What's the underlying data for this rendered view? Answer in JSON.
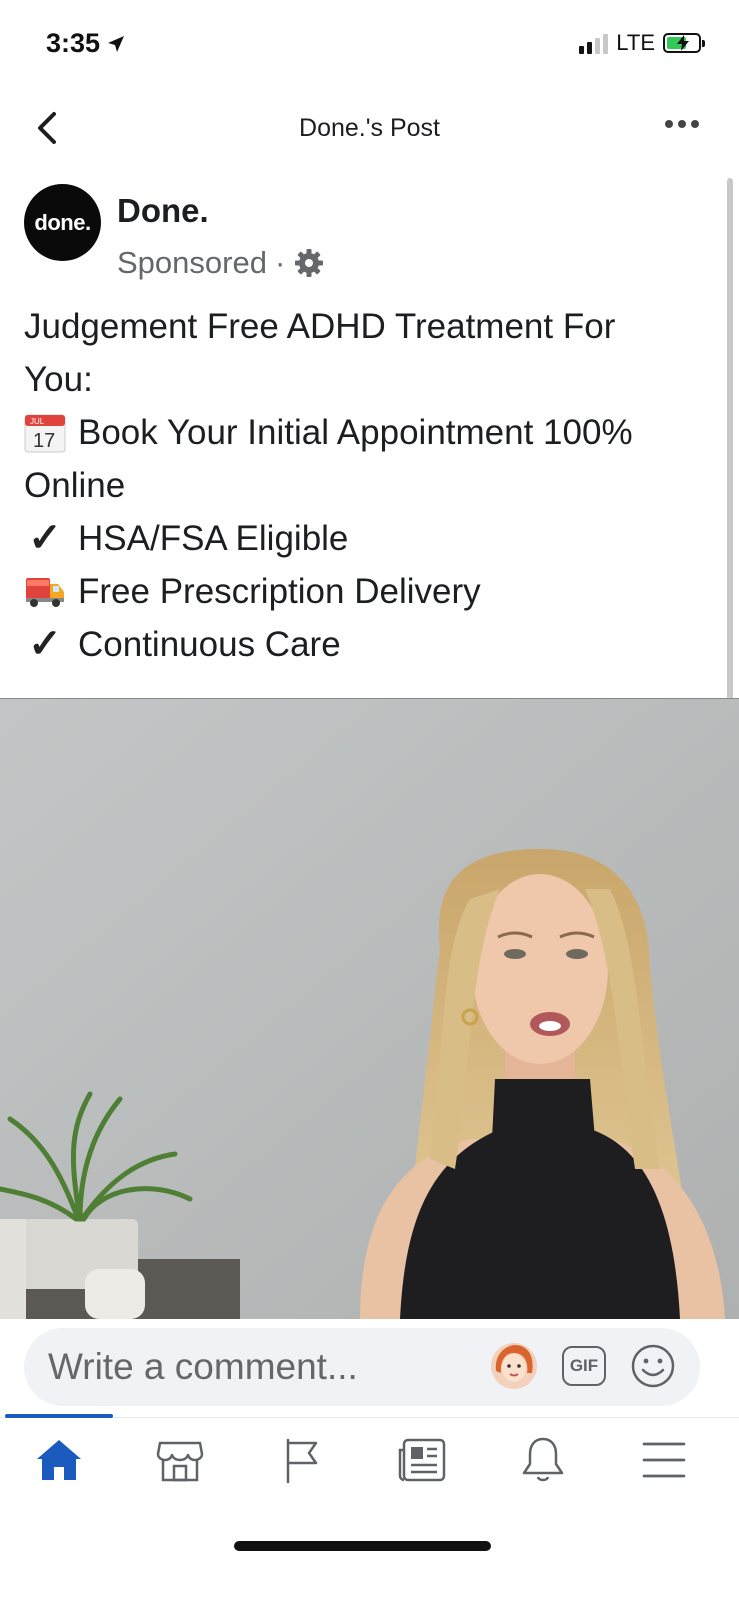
{
  "status_bar": {
    "time": "3:35",
    "network": "LTE"
  },
  "header": {
    "title": "Done.'s Post"
  },
  "post": {
    "avatar_text": "done.",
    "author": "Done.",
    "sponsored": "Sponsored",
    "separator": "·",
    "lines": [
      "Judgement Free ADHD Treatment For",
      "You:",
      "Book Your Initial Appointment 100%",
      "Online",
      "HSA/FSA Eligible",
      "Free Prescription Delivery",
      "Continuous Care"
    ],
    "calendar_emoji": {
      "month": "JUL",
      "day": "17"
    },
    "check_symbol": "✓"
  },
  "comment": {
    "placeholder": "Write a comment...",
    "gif_label": "GIF"
  },
  "tabs": [
    {
      "name": "home-icon",
      "active": true
    },
    {
      "name": "marketplace-icon",
      "active": false
    },
    {
      "name": "pages-flag-icon",
      "active": false
    },
    {
      "name": "news-icon",
      "active": false
    },
    {
      "name": "notifications-bell-icon",
      "active": false
    },
    {
      "name": "menu-icon",
      "active": false
    }
  ],
  "colors": {
    "accent": "#1b5bbd",
    "secondary_text": "#65676b",
    "comment_bg": "#f0f2f5"
  }
}
